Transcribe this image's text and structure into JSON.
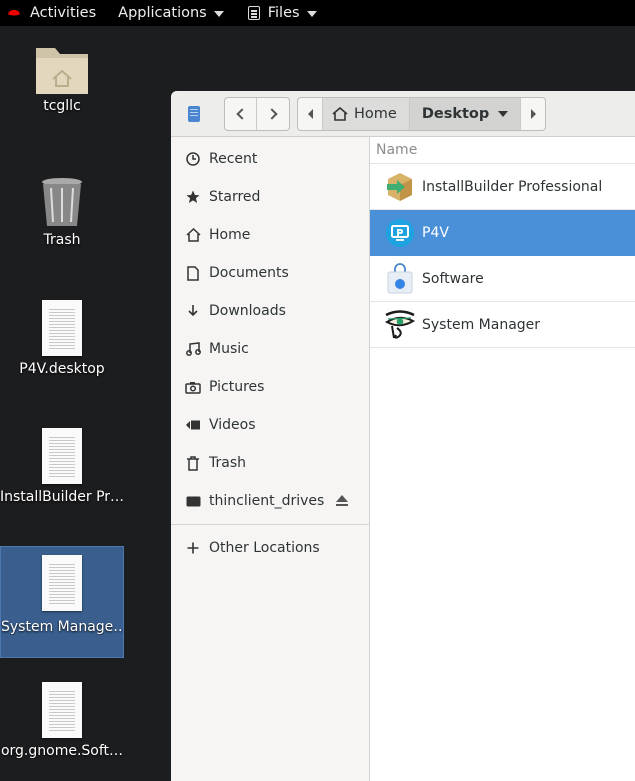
{
  "topbar": {
    "activities": "Activities",
    "applications": "Applications",
    "files": "Files"
  },
  "desktop": {
    "icons": [
      {
        "label": "tcgllc",
        "icon": "home-folder-icon"
      },
      {
        "label": "Trash",
        "icon": "trash-icon"
      },
      {
        "label": "P4V.desktop",
        "icon": "document-icon"
      },
      {
        "label": "InstallBuilder Pr…",
        "icon": "document-icon"
      },
      {
        "label": "System Manage…",
        "icon": "document-icon",
        "selected": true
      },
      {
        "label": "org.gnome.Soft…",
        "icon": "document-icon"
      }
    ]
  },
  "window": {
    "path": {
      "home": "Home",
      "current": "Desktop"
    },
    "sidebar": {
      "items": [
        {
          "label": "Recent",
          "icon": "clock-icon"
        },
        {
          "label": "Starred",
          "icon": "star-icon"
        },
        {
          "label": "Home",
          "icon": "home-icon"
        },
        {
          "label": "Documents",
          "icon": "document-icon"
        },
        {
          "label": "Downloads",
          "icon": "download-icon"
        },
        {
          "label": "Music",
          "icon": "music-icon"
        },
        {
          "label": "Pictures",
          "icon": "camera-icon"
        },
        {
          "label": "Videos",
          "icon": "video-icon"
        },
        {
          "label": "Trash",
          "icon": "trash-icon"
        },
        {
          "label": "thinclient_drives",
          "icon": "drive-icon"
        },
        {
          "label": "Other Locations",
          "icon": "plus-icon"
        }
      ]
    },
    "list": {
      "column_name": "Name",
      "rows": [
        {
          "name": "InstallBuilder Professional",
          "icon": "installbuilder-icon",
          "selected": false
        },
        {
          "name": "P4V",
          "icon": "p4v-icon",
          "selected": true
        },
        {
          "name": "Software",
          "icon": "software-bag-icon",
          "selected": false
        },
        {
          "name": "System Manager",
          "icon": "eye-of-horus-icon",
          "selected": false
        }
      ]
    }
  }
}
